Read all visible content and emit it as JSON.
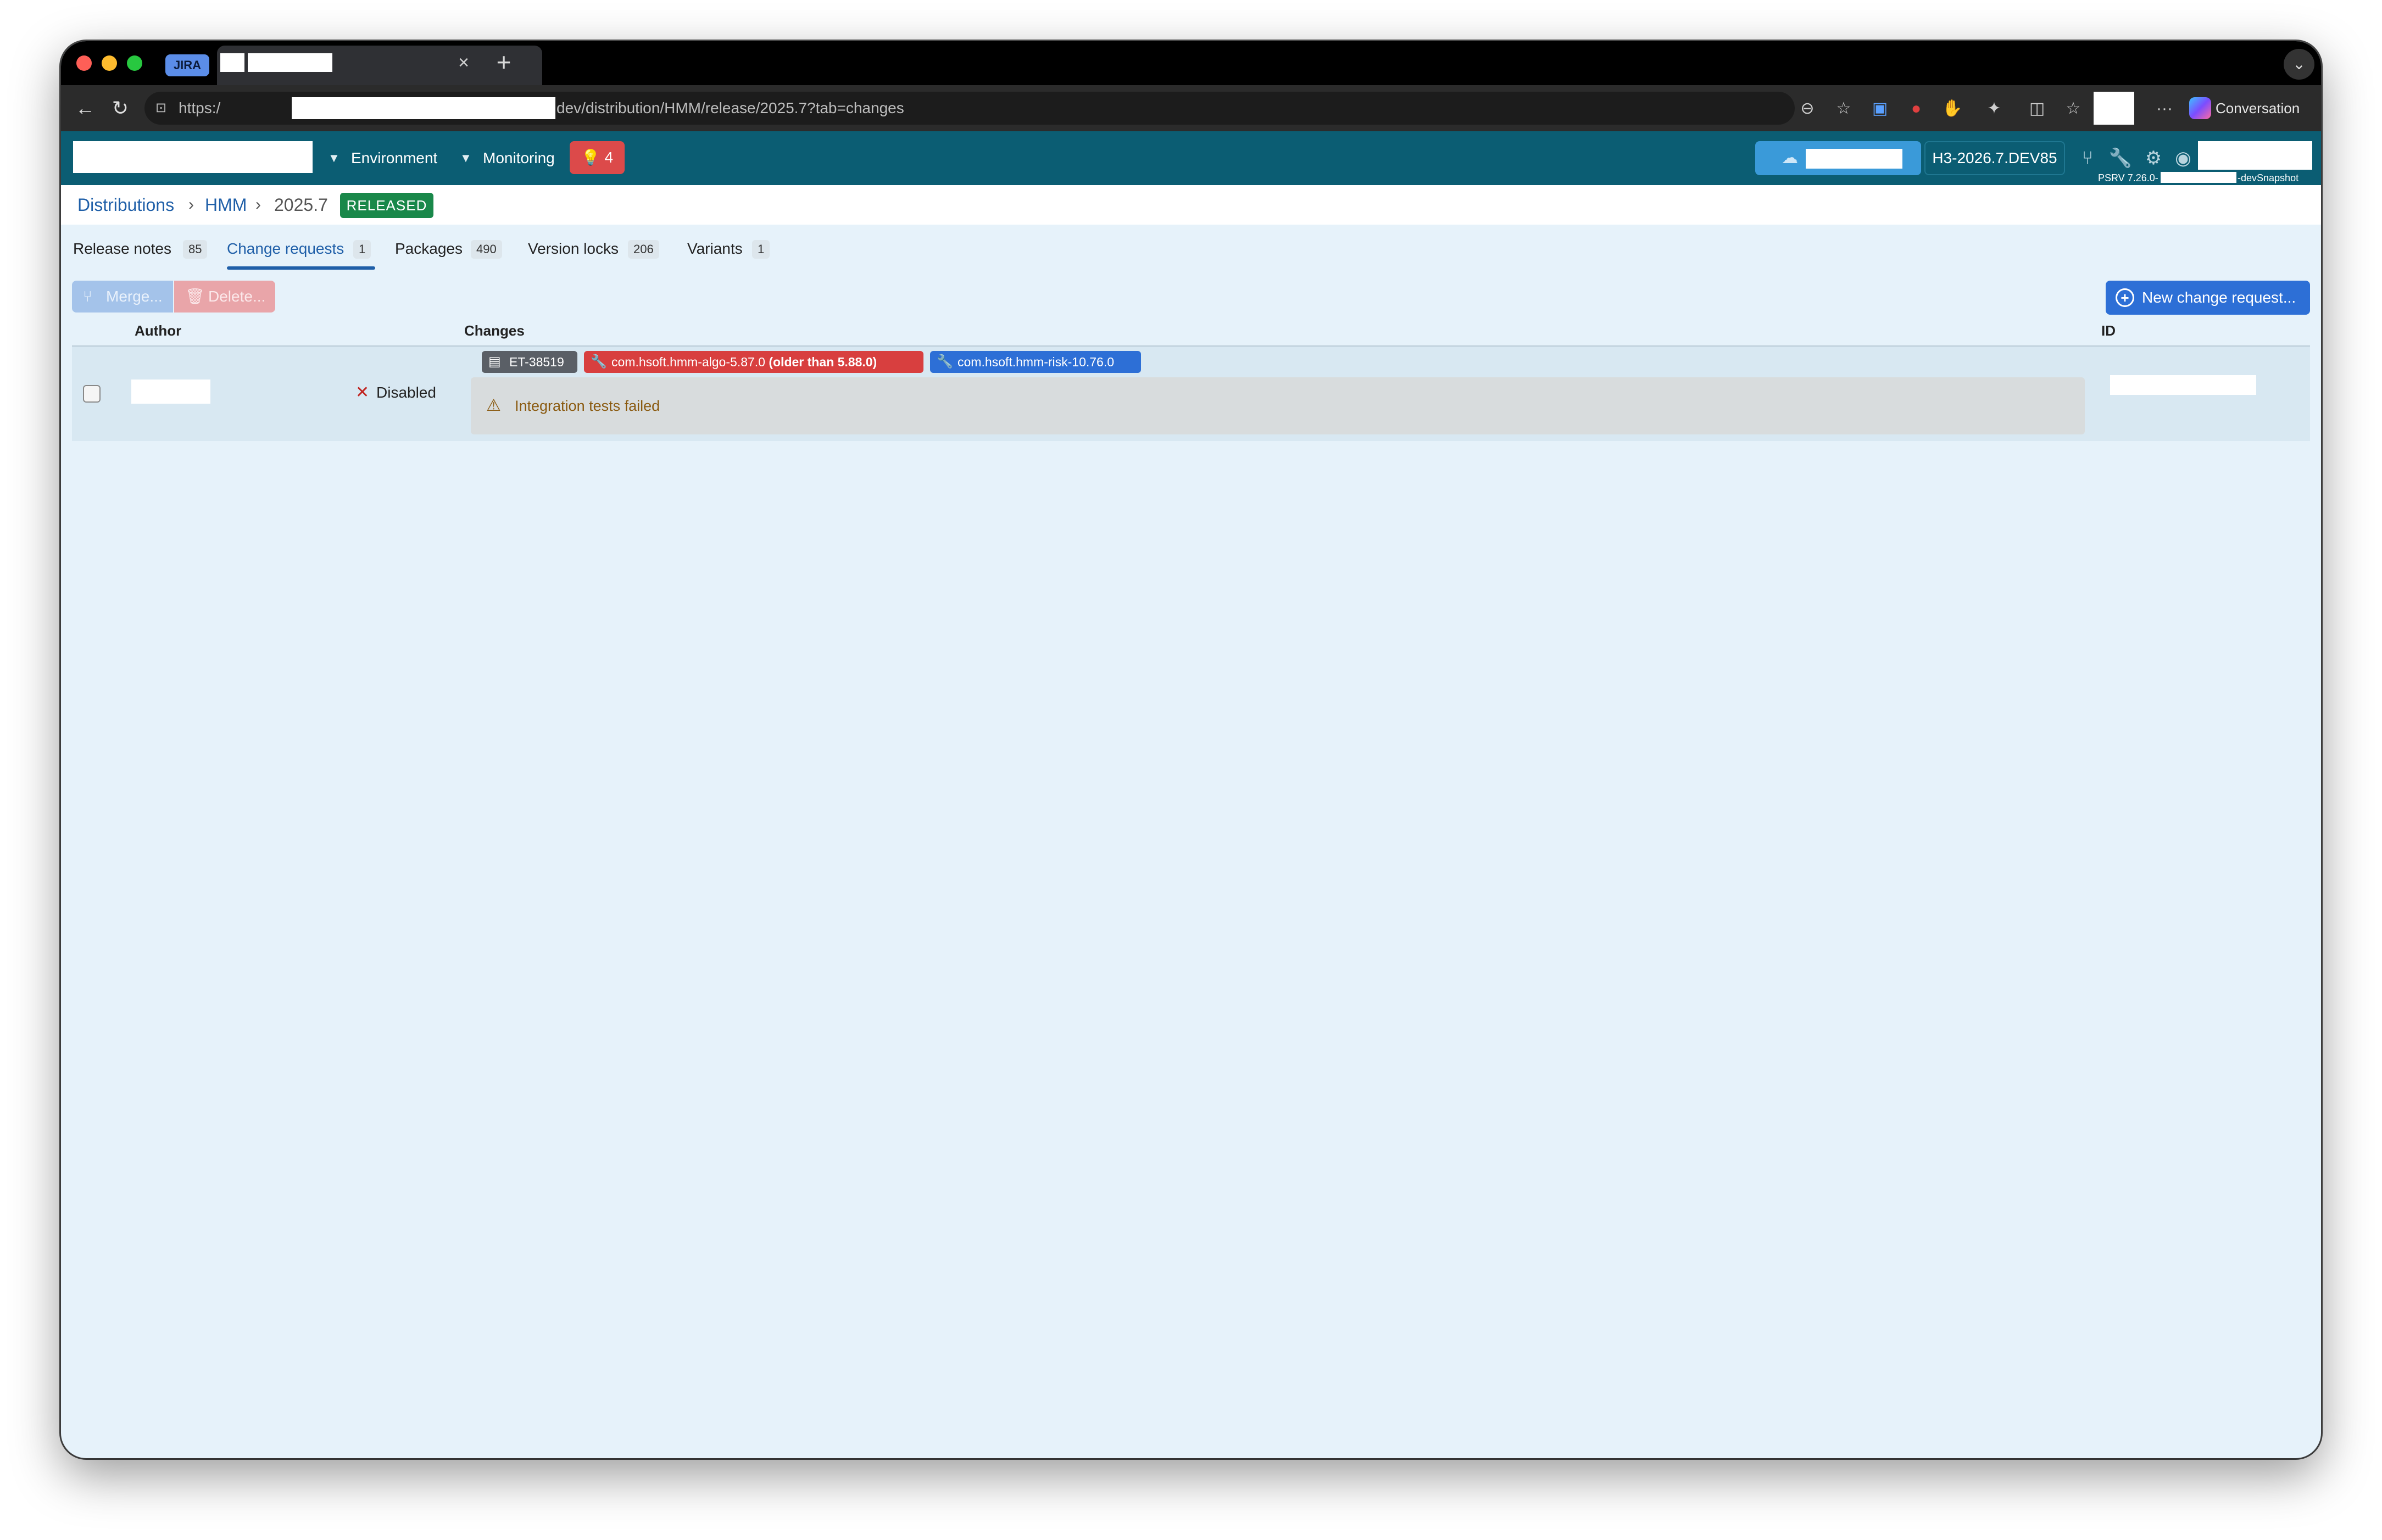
{
  "browser": {
    "tabs": [
      {
        "label": "JIRA",
        "kind": "group-pill"
      }
    ],
    "new_tab_label": "+",
    "close_tab_label": "×",
    "url_prefix": "https:/",
    "url_suffix": "dev/distribution/HMM/release/2025.7?tab=changes",
    "conversation_label": "Conversation",
    "more_label": "···"
  },
  "header": {
    "environment_label": "Environment",
    "monitoring_label": "Monitoring",
    "alert_count": "4",
    "version": "H3-2026.7.DEV85",
    "psrv_prefix": "PSRV 7.26.0-",
    "psrv_suffix": "-devSnapshot"
  },
  "breadcrumb": {
    "items": [
      "Distributions",
      "HMM",
      "2025.7"
    ],
    "status_badge": "RELEASED"
  },
  "tabs": [
    {
      "label": "Release notes",
      "count": "85"
    },
    {
      "label": "Change requests",
      "count": "1",
      "active": true
    },
    {
      "label": "Packages",
      "count": "490"
    },
    {
      "label": "Version locks",
      "count": "206"
    },
    {
      "label": "Variants",
      "count": "1"
    }
  ],
  "toolbar": {
    "merge_label": "Merge...",
    "delete_label": "Delete...",
    "new_request_label": "New change request..."
  },
  "table": {
    "columns": {
      "author": "Author",
      "changes": "Changes",
      "id": "ID"
    },
    "rows": [
      {
        "status": "Disabled",
        "chips": {
          "ticket": "ET-38519",
          "algo": "com.hsoft.hmm-algo-5.87.0",
          "algo_note": "(older than 5.88.0)",
          "risk": "com.hsoft.hmm-risk-10.76.0"
        },
        "warning": "Integration tests failed"
      }
    ]
  },
  "colors": {
    "header_bg": "#0b5d73",
    "page_bg": "#e6f2fa",
    "released_badge": "#19884a",
    "alert_badge": "#dc4a4a",
    "primary_button": "#2d6fd6",
    "chip_error": "#d83f3f"
  }
}
